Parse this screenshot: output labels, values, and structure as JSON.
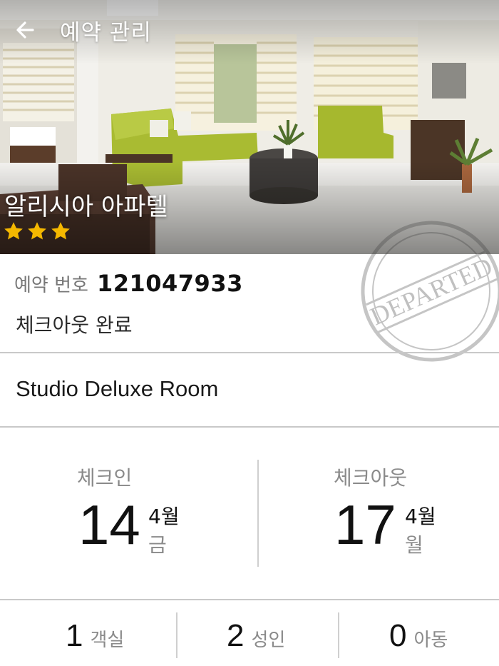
{
  "header": {
    "title": "예약 관리",
    "back_icon": "arrow-left-icon"
  },
  "hotel": {
    "name": "알리시아 아파텔",
    "star_rating": 3,
    "star_color": "#f5b800"
  },
  "stamp": {
    "text": "DEPARTED"
  },
  "reservation": {
    "number_label": "예약 번호",
    "number": "121047933",
    "status": "체크아웃 완료"
  },
  "room": {
    "name": "Studio Deluxe Room"
  },
  "checkin": {
    "label": "체크인",
    "day": "14",
    "month": "4월",
    "weekday": "금"
  },
  "checkout": {
    "label": "체크아웃",
    "day": "17",
    "month": "4월",
    "weekday": "월"
  },
  "guests": {
    "rooms_count": "1",
    "rooms_label": "객실",
    "adults_count": "2",
    "adults_label": "성인",
    "children_count": "0",
    "children_label": "아동"
  }
}
